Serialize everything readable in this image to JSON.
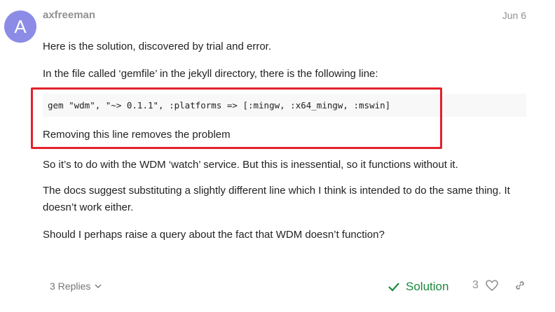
{
  "post": {
    "avatar_letter": "A",
    "avatar_color": "#8c8ce6",
    "username": "axfreeman",
    "date": "Jun 6",
    "paragraphs": {
      "p1": "Here is the solution, discovered by trial and error.",
      "p2": "In the file called ‘gemfile’ in the jekyll directory, there is the following line:",
      "code": "gem \"wdm\", \"~> 0.1.1\", :platforms => [:mingw, :x64_mingw, :mswin]",
      "p3": "Removing this line removes the problem",
      "p4": "So it’s to do with the WDM ‘watch’ service. But this is inessential, so it functions without it.",
      "p5": "The docs suggest substituting a slightly different line which I think is intended to do the same thing. It doesn’t work either.",
      "p6": "Should I perhaps raise a query about the fact that WDM doesn’t function?"
    },
    "highlight_color": "#e2212b"
  },
  "footer": {
    "replies_label": "3 Replies",
    "solution_label": "Solution",
    "solution_color": "#1a8a3c",
    "like_count": "3",
    "icons": [
      "chevron-down-icon",
      "check-icon",
      "heart-icon",
      "link-icon"
    ]
  }
}
